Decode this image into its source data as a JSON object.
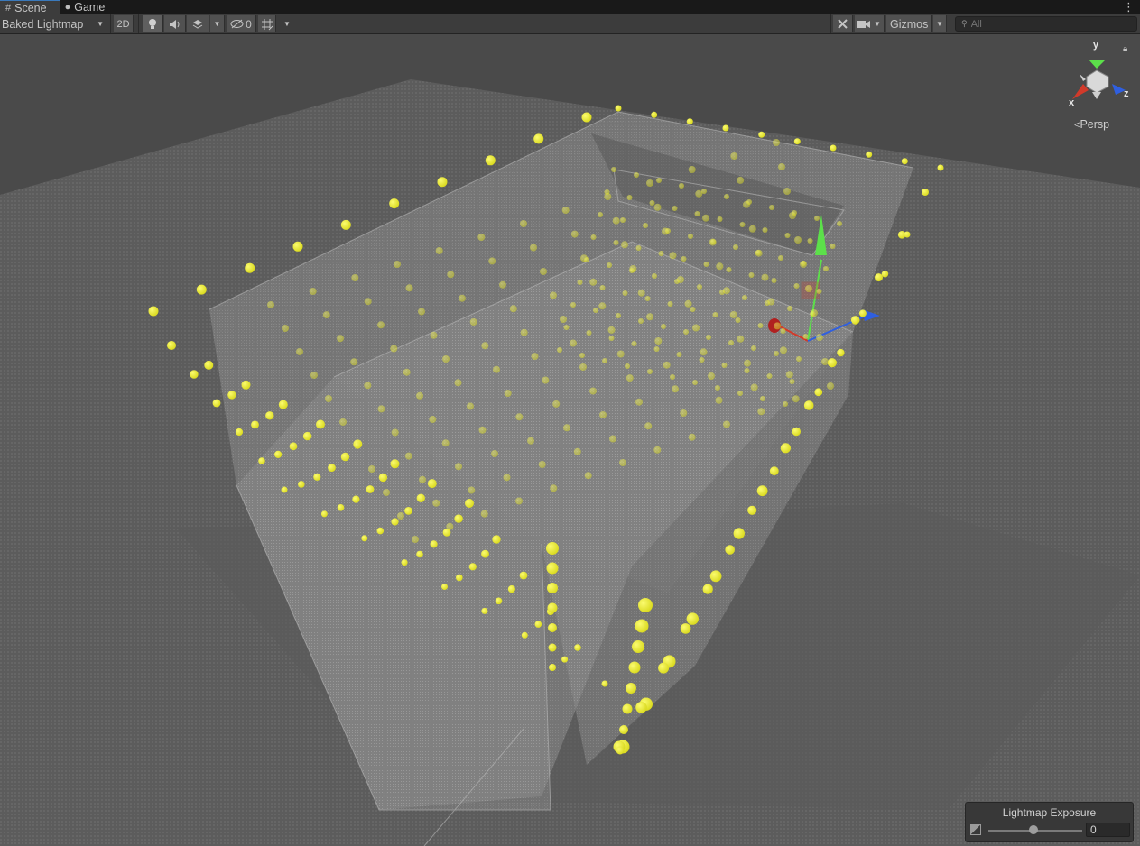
{
  "tabs": [
    {
      "label": "Scene",
      "icon": "grid-icon",
      "active": true
    },
    {
      "label": "Game",
      "icon": "gamepad-icon",
      "active": false
    }
  ],
  "toolbar": {
    "draw_mode": "Baked Lightmap",
    "toggle_2d": "2D",
    "hidden_count": "0",
    "gizmos": "Gizmos",
    "search_placeholder": "All"
  },
  "orientation_gizmo": {
    "axis_y": "y",
    "axis_x": "x",
    "axis_z": "z",
    "projection": "Persp"
  },
  "lightmap_exposure": {
    "title": "Lightmap Exposure",
    "value": "0"
  },
  "colors": {
    "light_probe": "#e8e82a",
    "handle_y": "#5ce04a",
    "handle_x": "#d23a2a",
    "handle_z": "#2f5fe0",
    "tab_accent": "#3a79bb"
  }
}
